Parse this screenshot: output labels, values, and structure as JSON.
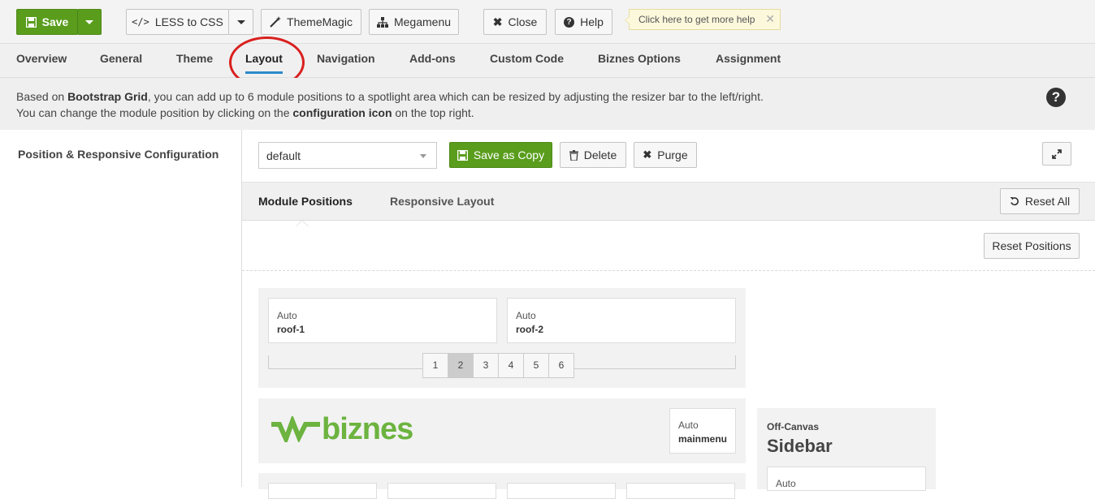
{
  "toolbar": {
    "save": "Save",
    "less_to_css": "LESS to CSS",
    "thememagic": "ThemeMagic",
    "megamenu": "Megamenu",
    "close": "Close",
    "help": "Help",
    "tooltip": "Click here to get more help"
  },
  "tabs": [
    "Overview",
    "General",
    "Theme",
    "Layout",
    "Navigation",
    "Add-ons",
    "Custom Code",
    "Biznes Options",
    "Assignment"
  ],
  "active_tab": "Layout",
  "info": {
    "line1_a": "Based on ",
    "line1_b": "Bootstrap Grid",
    "line1_c": ", you can add up to 6 module positions to a spotlight area which can be resized by adjusting the resizer bar to the left/right.",
    "line2_a": "You can change the module position by clicking on the ",
    "line2_b": "configuration icon",
    "line2_c": " on the top right."
  },
  "left_title": "Position & Responsive Configuration",
  "layout_select": "default",
  "buttons": {
    "save_copy": "Save as Copy",
    "delete": "Delete",
    "purge": "Purge",
    "reset_all": "Reset All",
    "reset_positions": "Reset Positions"
  },
  "subtabs": [
    "Module Positions",
    "Responsive Layout"
  ],
  "positions": {
    "roof1": {
      "width": "Auto",
      "name": "roof-1"
    },
    "roof2": {
      "width": "Auto",
      "name": "roof-2"
    },
    "mainmenu": {
      "width": "Auto",
      "name": "mainmenu"
    },
    "offcanvas": {
      "width": "Auto"
    }
  },
  "pager": [
    "1",
    "2",
    "3",
    "4",
    "5",
    "6"
  ],
  "pager_active": "2",
  "logo_text": "biznes",
  "offcanvas": {
    "label": "Off-Canvas",
    "title": "Sidebar"
  },
  "colors": {
    "accent": "#5a9d1d",
    "tab_underline": "#2a8ac9",
    "logo": "#6cb33f",
    "highlight_ring": "#d9201e"
  }
}
